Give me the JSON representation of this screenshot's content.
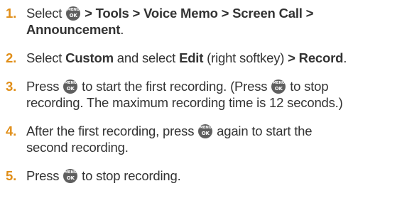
{
  "icons": {
    "menu_ok_top": "MENU",
    "menu_ok_bottom": "OK",
    "menu_ok_color": "#5f5f5f"
  },
  "accent_color": "#e08e18",
  "steps": [
    {
      "number": "1.",
      "text": {
        "a": "Select ",
        "b": " > Tools > Voice Memo > Screen Call >",
        "c": "Announcement",
        "d": "."
      }
    },
    {
      "number": "2.",
      "text": {
        "a": "Select ",
        "b": "Custom",
        "c": " and select ",
        "d": "Edit",
        "e": " (right softkey) ",
        "f": "> Record",
        "g": "."
      }
    },
    {
      "number": "3.",
      "text": {
        "a": "Press ",
        "b": " to start the first recording. (Press ",
        "c": " to stop",
        "d": "recording. The maximum recording time is 12 seconds.)"
      }
    },
    {
      "number": "4.",
      "text": {
        "a": "After the first recording, press ",
        "b": " again to start the",
        "c": "second recording."
      }
    },
    {
      "number": "5.",
      "text": {
        "a": "Press ",
        "b": " to stop recording."
      }
    }
  ]
}
